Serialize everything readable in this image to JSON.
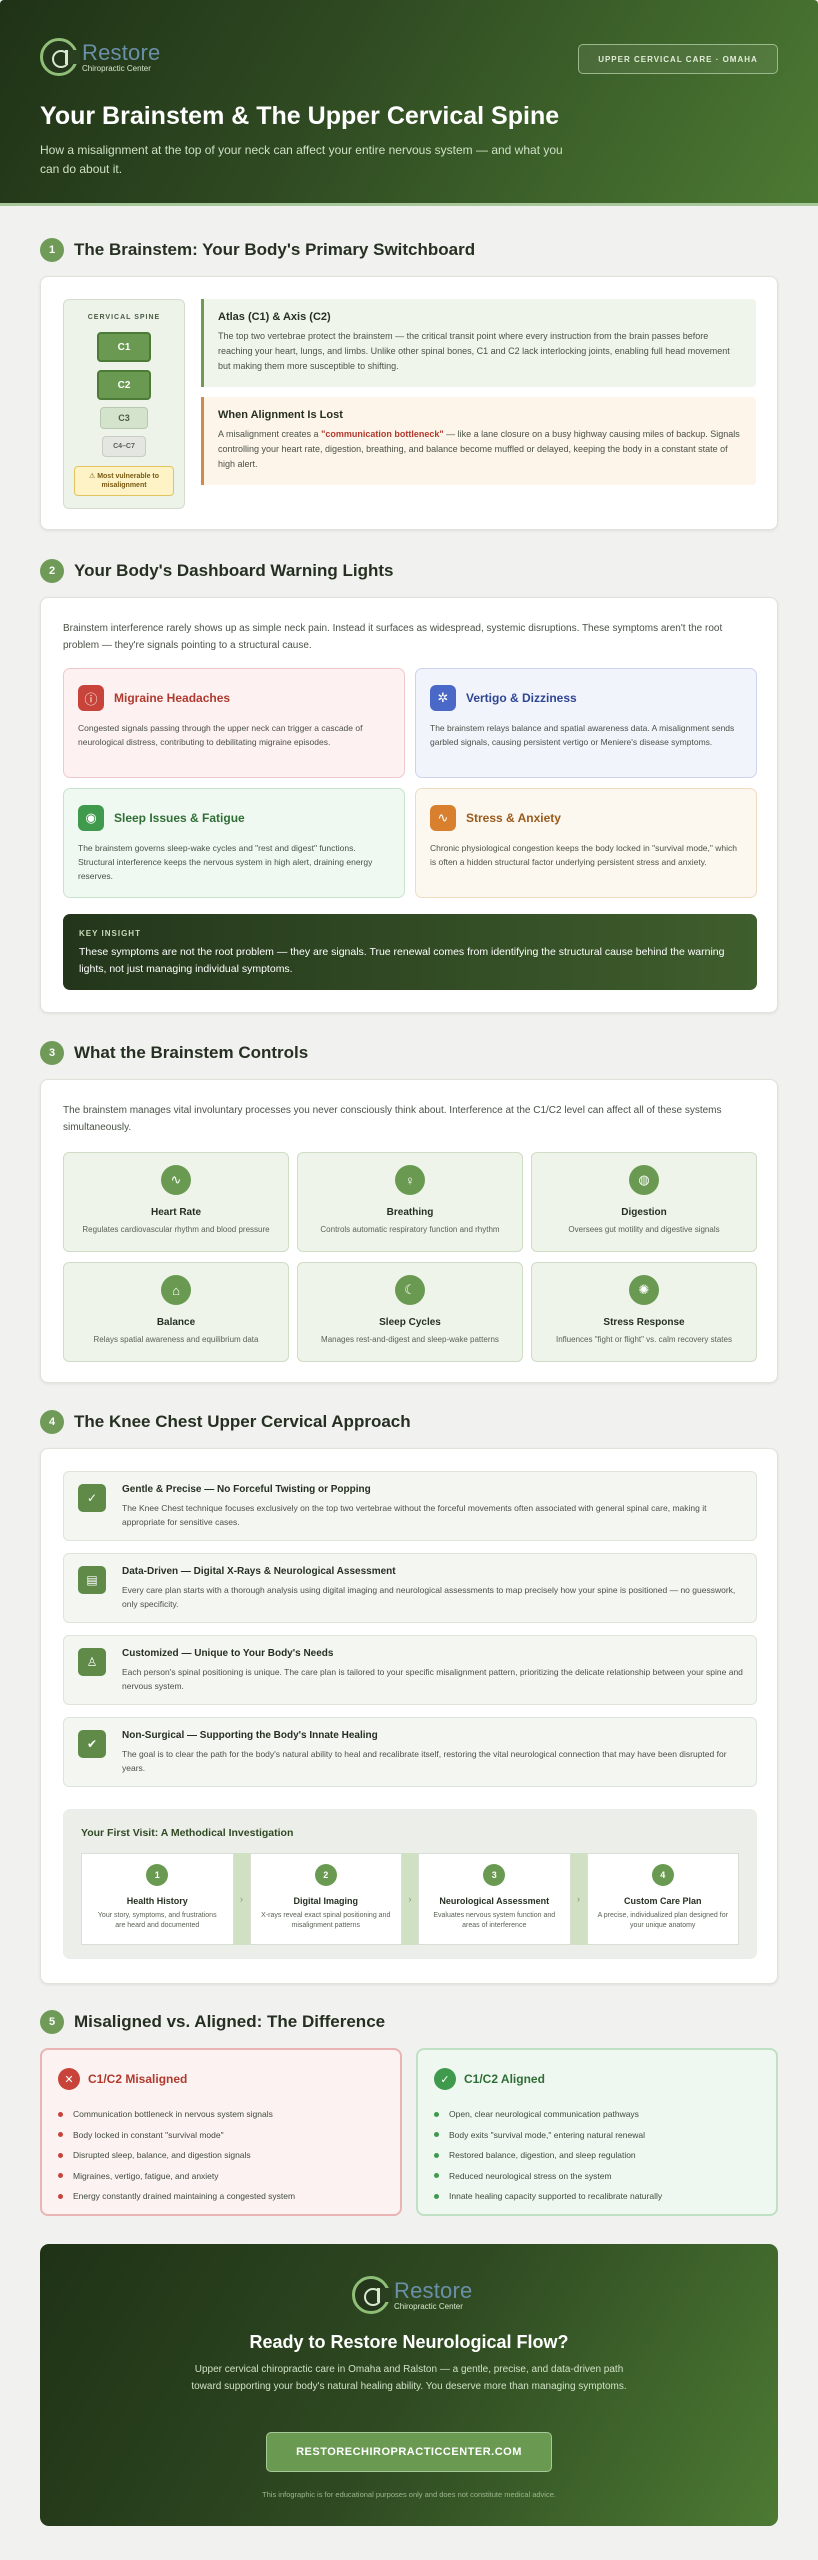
{
  "hero": {
    "logo_name": "Restore",
    "logo_sub": "Chiropractic Center",
    "badge": "UPPER CERVICAL CARE · OMAHA",
    "title": "Your Brainstem & The Upper Cervical Spine",
    "subtitle": "How a misalignment at the top of your neck can affect your entire nervous system — and what you can do about it."
  },
  "s1": {
    "num": "1",
    "title": "The Brainstem: Your Body's Primary Switchboard",
    "spine_label": "CERVICAL SPINE",
    "c1": "C1",
    "c2": "C2",
    "c3": "C3",
    "c4": "C4–C7",
    "note": "⚠ Most vulnerable to misalignment",
    "atlas_title": "Atlas (C1) & Axis (C2)",
    "atlas_text": "The top two vertebrae protect the brainstem — the critical transit point where every instruction from the brain passes before reaching your heart, lungs, and limbs. Unlike other spinal bones, C1 and C2 lack interlocking joints, enabling full head movement but making them more susceptible to shifting.",
    "lost_title": "When Alignment Is Lost",
    "lost_pre": "A misalignment creates a ",
    "lost_hl": "\"communication bottleneck\"",
    "lost_post": " — like a lane closure on a busy highway causing miles of backup. Signals controlling your heart rate, digestion, breathing, and balance become muffled or delayed, keeping the body in a constant state of high alert."
  },
  "s2": {
    "num": "2",
    "title": "Your Body's Dashboard Warning Lights",
    "intro": "Brainstem interference rarely shows up as simple neck pain. Instead it surfaces as widespread, systemic disruptions. These symptoms aren't the root problem — they're signals pointing to a structural cause.",
    "symptoms": [
      {
        "icon": "ⓘ",
        "title": "Migraine Headaches",
        "text": "Congested signals passing through the upper neck can trigger a cascade of neurological distress, contributing to debilitating migraine episodes."
      },
      {
        "icon": "✲",
        "title": "Vertigo & Dizziness",
        "text": "The brainstem relays balance and spatial awareness data. A misalignment sends garbled signals, causing persistent vertigo or Meniere's disease symptoms."
      },
      {
        "icon": "◉",
        "title": "Sleep Issues & Fatigue",
        "text": "The brainstem governs sleep-wake cycles and \"rest and digest\" functions. Structural interference keeps the nervous system in high alert, draining energy reserves."
      },
      {
        "icon": "∿",
        "title": "Stress & Anxiety",
        "text": "Chronic physiological congestion keeps the body locked in \"survival mode,\" which is often a hidden structural factor underlying persistent stress and anxiety."
      }
    ],
    "insight_label": "KEY INSIGHT",
    "insight_text": "These symptoms are not the root problem — they are signals. True renewal comes from identifying the structural cause behind the warning lights, not just managing individual symptoms."
  },
  "s3": {
    "num": "3",
    "title": "What the Brainstem Controls",
    "intro": "The brainstem manages vital involuntary processes you never consciously think about. Interference at the C1/C2 level can affect all of these systems simultaneously.",
    "items": [
      {
        "icon": "∿",
        "title": "Heart Rate",
        "text": "Regulates cardiovascular rhythm and blood pressure"
      },
      {
        "icon": "♀",
        "title": "Breathing",
        "text": "Controls automatic respiratory function and rhythm"
      },
      {
        "icon": "◍",
        "title": "Digestion",
        "text": "Oversees gut motility and digestive signals"
      },
      {
        "icon": "⌂",
        "title": "Balance",
        "text": "Relays spatial awareness and equilibrium data"
      },
      {
        "icon": "☾",
        "title": "Sleep Cycles",
        "text": "Manages rest-and-digest and sleep-wake patterns"
      },
      {
        "icon": "✺",
        "title": "Stress Response",
        "text": "Influences \"fight or flight\" vs. calm recovery states"
      }
    ]
  },
  "s4": {
    "num": "4",
    "title": "The Knee Chest Upper Cervical Approach",
    "features": [
      {
        "icon": "✓",
        "title": "Gentle & Precise — No Forceful Twisting or Popping",
        "text": "The Knee Chest technique focuses exclusively on the top two vertebrae without the forceful movements often associated with general spinal care, making it appropriate for sensitive cases."
      },
      {
        "icon": "▤",
        "title": "Data-Driven — Digital X-Rays & Neurological Assessment",
        "text": "Every care plan starts with a thorough analysis using digital imaging and neurological assessments to map precisely how your spine is positioned — no guesswork, only specificity."
      },
      {
        "icon": "♙",
        "title": "Customized — Unique to Your Body's Needs",
        "text": "Each person's spinal positioning is unique. The care plan is tailored to your specific misalignment pattern, prioritizing the delicate relationship between your spine and nervous system."
      },
      {
        "icon": "✔",
        "title": "Non-Surgical — Supporting the Body's Innate Healing",
        "text": "The goal is to clear the path for the body's natural ability to heal and recalibrate itself, restoring the vital neurological connection that may have been disrupted for years."
      }
    ],
    "visit_title": "Your First Visit: A Methodical Investigation",
    "arrow": "›",
    "steps": [
      {
        "num": "1",
        "title": "Health History",
        "text": "Your story, symptoms, and frustrations are heard and documented"
      },
      {
        "num": "2",
        "title": "Digital Imaging",
        "text": "X-rays reveal exact spinal positioning and misalignment patterns"
      },
      {
        "num": "3",
        "title": "Neurological Assessment",
        "text": "Evaluates nervous system function and areas of interference"
      },
      {
        "num": "4",
        "title": "Custom Care Plan",
        "text": "A precise, individualized plan designed for your unique anatomy"
      }
    ]
  },
  "s5": {
    "num": "5",
    "title": "Misaligned vs. Aligned: The Difference",
    "bad_icon": "✕",
    "bad_title": "C1/C2 Misaligned",
    "bad_items": [
      "Communication bottleneck in nervous system signals",
      "Body locked in constant \"survival mode\"",
      "Disrupted sleep, balance, and digestion signals",
      "Migraines, vertigo, fatigue, and anxiety",
      "Energy constantly drained maintaining a congested system"
    ],
    "good_icon": "✓",
    "good_title": "C1/C2 Aligned",
    "good_items": [
      "Open, clear neurological communication pathways",
      "Body exits \"survival mode,\" entering natural renewal",
      "Restored balance, digestion, and sleep regulation",
      "Reduced neurological stress on the system",
      "Innate healing capacity supported to recalibrate naturally"
    ]
  },
  "footer": {
    "logo_name": "Restore",
    "logo_sub": "Chiropractic Center",
    "title": "Ready to Restore Neurological Flow?",
    "text": "Upper cervical chiropractic care in Omaha and Ralston — a gentle, precise, and data-driven path toward supporting your body's natural healing ability. You deserve more than managing symptoms.",
    "button": "RESTORECHIROPRACTICCENTER.COM",
    "disclaimer": "This infographic is for educational purposes only and does not constitute medical advice."
  }
}
